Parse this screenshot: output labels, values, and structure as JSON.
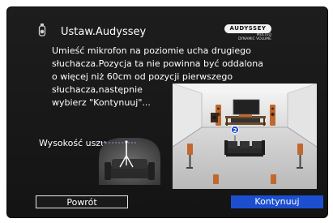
{
  "header": {
    "title": "Ustaw.Audyssey",
    "icon": "microphone-icon",
    "logo_text": "AUDYSSEY",
    "logo_subtext": [
      "MULTEQ",
      "DYNAMIC VOLUME"
    ]
  },
  "instructions": {
    "lines": [
      "Umieść mikrofon na poziomie ucha drugiego",
      "słuchacza.Pozycja ta nie powinna być oddalona",
      "o więcej niż 60cm od pozycji pierwszego",
      "słuchacza,następnie",
      "wybierz \"Kontynuuj\"..."
    ]
  },
  "room_diagram": {
    "mic_position_label": "2"
  },
  "ear_height": {
    "label": "Wysokość uszu"
  },
  "buttons": {
    "back_label": "Powrót",
    "next_label": "Kontynuuj"
  },
  "colors": {
    "background": "#1a1a1a",
    "accent": "#1c4fd0",
    "text": "#ffffff"
  }
}
